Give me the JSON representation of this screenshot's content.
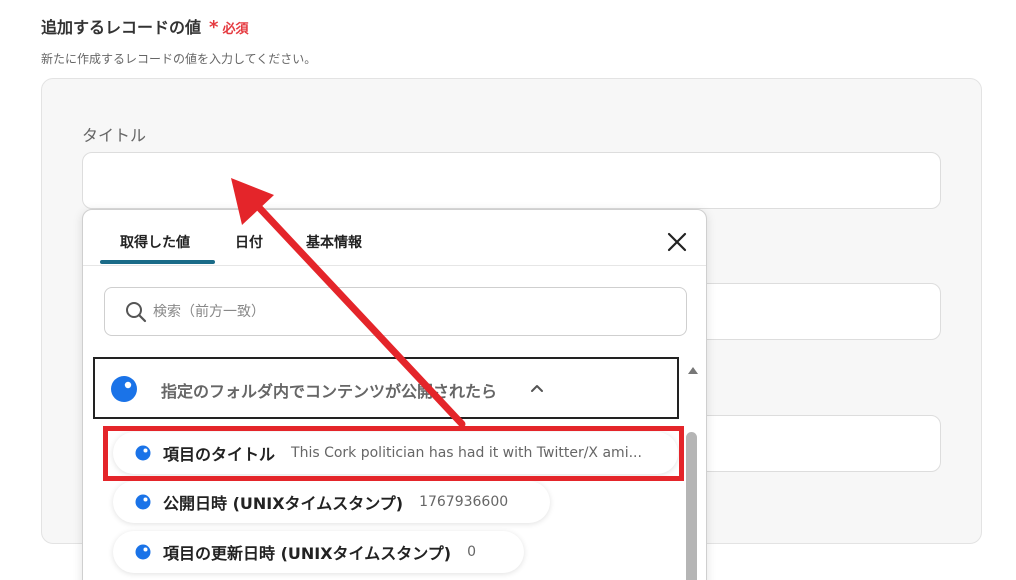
{
  "section": {
    "title": "追加するレコードの値",
    "required_mark": "*",
    "required_label": "必須",
    "description": "新たに作成するレコードの値を入力してください。"
  },
  "fields": [
    {
      "label": "タイトル",
      "value": ""
    }
  ],
  "popup": {
    "tabs": [
      {
        "label": "取得した値",
        "active": true
      },
      {
        "label": "日付",
        "active": false
      },
      {
        "label": "基本情報",
        "active": false
      }
    ],
    "search": {
      "placeholder": "検索（前方一致）",
      "value": ""
    },
    "group": {
      "label": "指定のフォルダ内でコンテンツが公開されたら",
      "expanded": true
    },
    "items": [
      {
        "label": "項目のタイトル",
        "value": "This Cork politician has had it with Twitter/X ami..."
      },
      {
        "label": "公開日時 (UNIXタイムスタンプ)",
        "value": "1767936600"
      },
      {
        "label": "項目の更新日時 (UNIXタイムスタンプ)",
        "value": "0"
      }
    ]
  },
  "colors": {
    "accent_blue": "#1a73e8",
    "tab_underline": "#1a6b88",
    "required_red": "#e53a40",
    "annotation_red": "#e4252a"
  },
  "icons": {
    "search": "search-icon",
    "close": "close-icon",
    "group": "circle-dot-icon",
    "chevron": "chevron-up-icon"
  }
}
